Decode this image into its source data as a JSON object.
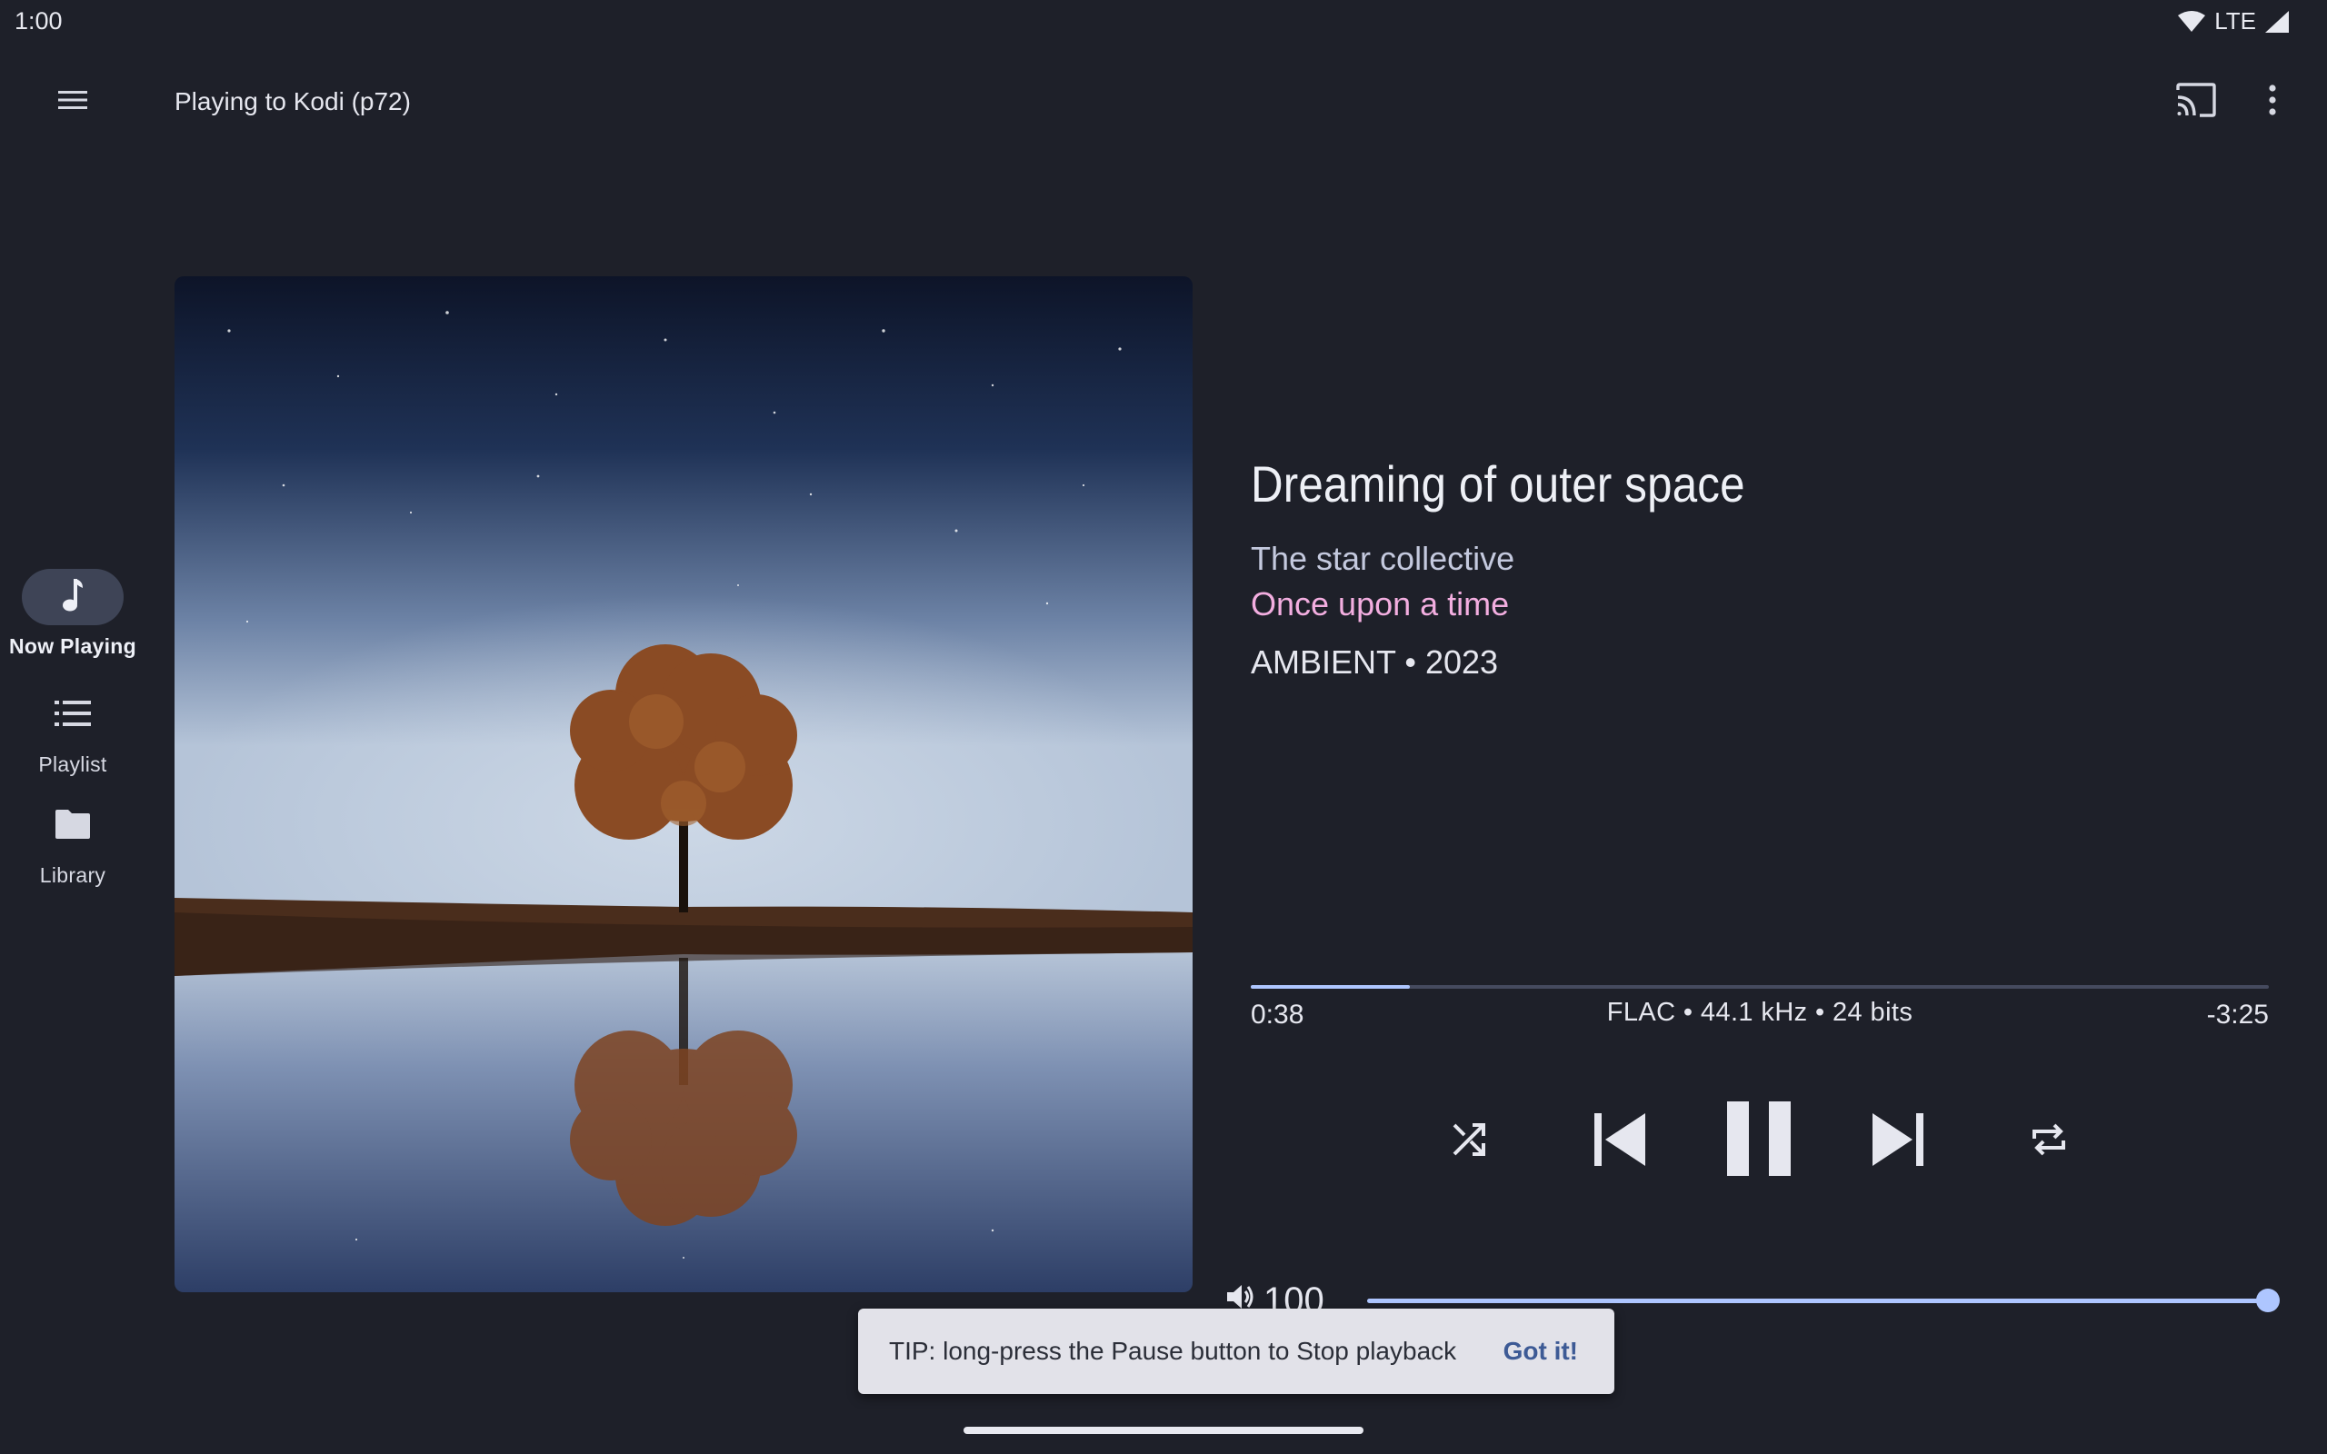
{
  "status_bar": {
    "time": "1:00",
    "network": "LTE"
  },
  "app_bar": {
    "title": "Playing to Kodi (p72)",
    "icons": [
      "menu-icon",
      "cast-icon",
      "more-vert-icon"
    ]
  },
  "nav_rail": {
    "items": [
      {
        "label": "Now Playing",
        "icon": "music-note-icon",
        "active": true
      },
      {
        "label": "Playlist",
        "icon": "list-icon",
        "active": false
      },
      {
        "label": "Library",
        "icon": "folder-icon",
        "active": false
      }
    ]
  },
  "track": {
    "title": "Dreaming of outer space",
    "artist": "The star collective",
    "album": "Once upon a time",
    "genre_year": "AMBIENT • 2023"
  },
  "playback": {
    "elapsed": "0:38",
    "remaining": "-3:25",
    "format": "FLAC • 44.1 kHz • 24 bits",
    "progress_fraction": 0.156,
    "controls": [
      "shuffle-icon",
      "skip-previous-icon",
      "pause-icon",
      "skip-next-icon",
      "repeat-icon"
    ]
  },
  "volume": {
    "value": "100",
    "level_fraction": 1.0
  },
  "snackbar": {
    "message": "TIP: long-press the Pause button to Stop playback",
    "action": "Got it!"
  },
  "colors": {
    "background": "#1e2029",
    "accent": "#aec6ff",
    "album_text": "#f3aee0",
    "nav_active_pill": "#3e4456",
    "snackbar_bg": "#e2e2e9",
    "snackbar_action": "#3d5a95"
  }
}
